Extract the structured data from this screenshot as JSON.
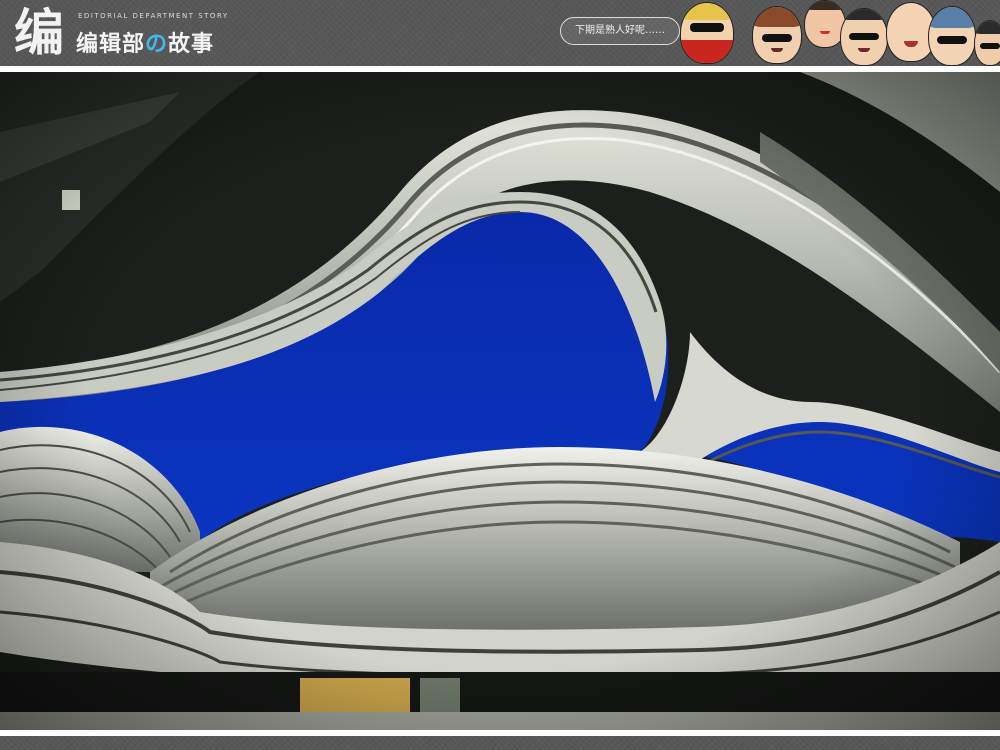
{
  "header": {
    "logo_mark": "编",
    "logo_subtitle": "EDITORIAL DEPARTMENT STORY",
    "title_prefix": "编辑部",
    "title_no": "の",
    "title_suffix": "故事",
    "speech_bubble": "下期是熟人好呢……"
  },
  "characters": [
    {
      "name": "blond-scarf",
      "hair": "#e8c34a",
      "skin": "#f3d2ad",
      "extra": "#c8261f"
    },
    {
      "name": "woman-brown-hair",
      "hair": "#8a4a2a",
      "skin": "#f2cfae",
      "extra": "#222222"
    },
    {
      "name": "angry-man",
      "hair": "#3a2a22",
      "skin": "#f0c6a4",
      "extra": "#c9302c"
    },
    {
      "name": "man-glasses",
      "hair": "#2a2a2a",
      "skin": "#f1d0b0",
      "extra": "#111111"
    },
    {
      "name": "bald-man",
      "hair": "#f1d0b0",
      "skin": "#f4d4b4",
      "extra": "#a33"
    },
    {
      "name": "woman-blue-hair",
      "hair": "#5a7fa8",
      "skin": "#f3d5b6",
      "extra": "#111111"
    },
    {
      "name": "dark-hair-edge",
      "hair": "#2b2b2b",
      "skin": "#f0cdaa",
      "extra": "#111111"
    }
  ],
  "colors": {
    "sky": "#0a2fb3",
    "metal": "#cfd2c8",
    "band_dark": "#3a3d36",
    "frame": "#ffffff",
    "accent": "#43b8f0"
  }
}
